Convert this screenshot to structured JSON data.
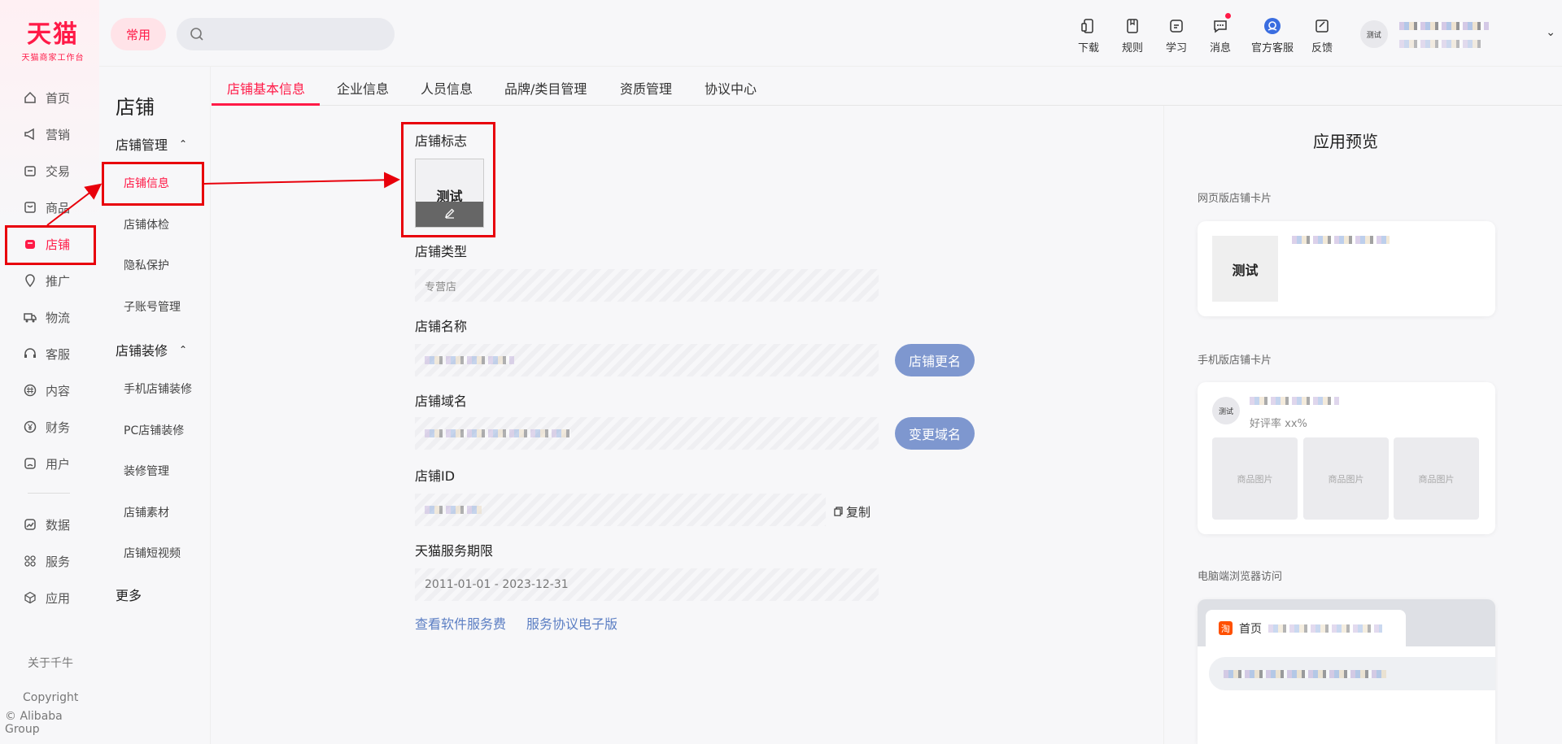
{
  "brand": {
    "name": "天猫",
    "subtitle": "天猫商家工作台",
    "color": "#ff1a47"
  },
  "rail": {
    "items": [
      {
        "label": "首页",
        "icon": "home-icon"
      },
      {
        "label": "营销",
        "icon": "megaphone-icon"
      },
      {
        "label": "交易",
        "icon": "calendar-icon"
      },
      {
        "label": "商品",
        "icon": "box-icon"
      },
      {
        "label": "店铺",
        "icon": "store-icon"
      },
      {
        "label": "推广",
        "icon": "location-icon"
      },
      {
        "label": "物流",
        "icon": "truck-icon"
      },
      {
        "label": "客服",
        "icon": "headset-icon"
      },
      {
        "label": "内容",
        "icon": "hash-icon"
      },
      {
        "label": "财务",
        "icon": "yen-icon"
      },
      {
        "label": "用户",
        "icon": "user-icon"
      },
      {
        "label": "数据",
        "icon": "chart-icon"
      },
      {
        "label": "服务",
        "icon": "grid-icon"
      },
      {
        "label": "应用",
        "icon": "cube-icon"
      }
    ],
    "about": "关于千牛",
    "copyright": "Copyright",
    "company": "© Alibaba Group"
  },
  "header": {
    "common_btn": "常用",
    "search": {
      "placeholder": ""
    },
    "buttons": [
      "下载",
      "规则",
      "学习",
      "消息",
      "官方客服",
      "反馈"
    ],
    "avatar_text": "测试"
  },
  "subnav": {
    "title": "店铺",
    "group1": "店铺管理",
    "group1_items": [
      "店铺信息",
      "店铺体检",
      "隐私保护",
      "子账号管理"
    ],
    "group2": "店铺装修",
    "group2_items": [
      "手机店铺装修",
      "PC店铺装修",
      "装修管理",
      "店铺素材",
      "店铺短视频"
    ],
    "more": "更多"
  },
  "tabs": [
    "店铺基本信息",
    "企业信息",
    "人员信息",
    "品牌/类目管理",
    "资质管理",
    "协议中心"
  ],
  "form": {
    "logo_label": "店铺标志",
    "logo_text": "测试",
    "type_label": "店铺类型",
    "type_value": "专营店",
    "name_label": "店铺名称",
    "rename_btn": "店铺更名",
    "domain_label": "店铺域名",
    "change_domain_btn": "变更域名",
    "id_label": "店铺ID",
    "copy_btn": "复制",
    "term_label": "天猫服务期限",
    "term_value": "2011-01-01 - 2023-12-31",
    "link1": "查看软件服务费",
    "link2": "服务协议电子版"
  },
  "preview": {
    "title": "应用预览",
    "web_label": "网页版店铺卡片",
    "web_logo": "测试",
    "mobile_label": "手机版店铺卡片",
    "mobile_avatar": "测试",
    "mobile_rating": "好评率 xx%",
    "product_placeholder": "商品图片",
    "pc_label": "电脑端浏览器访问",
    "pc_tab": "首页",
    "pc_tab_icon": "淘"
  },
  "colors": {
    "accent": "#ff1a47",
    "button": "#7e97cf",
    "link": "#5b7ec3",
    "annotation": "#e8000b"
  }
}
